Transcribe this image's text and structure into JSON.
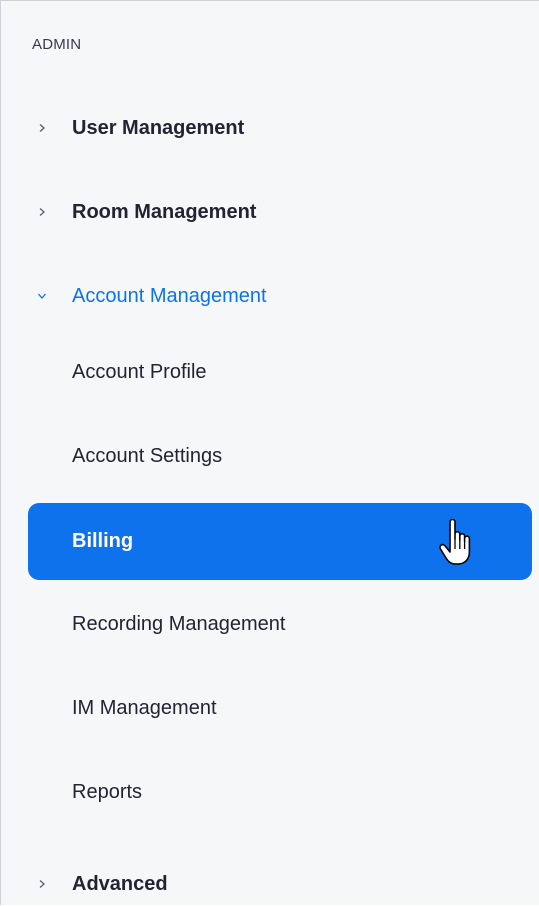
{
  "admin": {
    "section_label": "ADMIN",
    "items": [
      {
        "label": "User Management",
        "icon": "chevron-right-icon"
      },
      {
        "label": "Room Management",
        "icon": "chevron-right-icon"
      },
      {
        "label": "Account Management",
        "icon": "chevron-down-icon",
        "state": "expanded"
      },
      {
        "label": "Account Profile"
      },
      {
        "label": "Account Settings"
      },
      {
        "label": "Billing",
        "state": "active"
      },
      {
        "label": "Recording Management"
      },
      {
        "label": "IM Management"
      },
      {
        "label": "Reports"
      },
      {
        "label": "Advanced",
        "icon": "chevron-right-icon"
      }
    ]
  },
  "colors": {
    "accent": "#0e72ed",
    "background": "#f6f7f9",
    "text": "#232333"
  },
  "cursor_icon": "hand-pointer-icon"
}
